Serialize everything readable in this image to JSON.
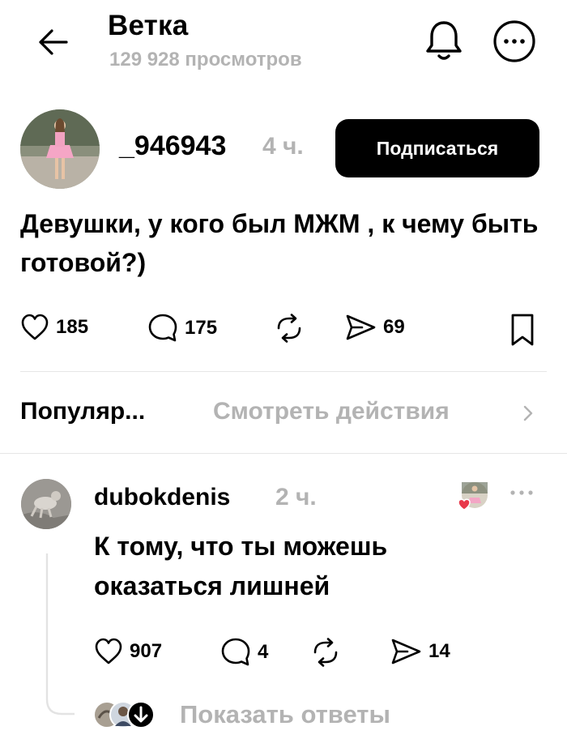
{
  "header": {
    "title": "Ветка",
    "views": "129 928 просмотров",
    "icons": {
      "back": "arrow-left-icon",
      "notifications": "bell-icon",
      "more": "more-horizontal-icon"
    }
  },
  "post": {
    "author": "_946943",
    "time": "4 ч.",
    "follow_label": "Подписаться",
    "text": "Девушки, у кого был МЖМ , к чему быть готовой?)",
    "likes": "185",
    "comments": "175",
    "shares": "69"
  },
  "sort": {
    "label": "Популяр...",
    "activity_label": "Смотреть действия"
  },
  "comment": {
    "author": "dubokdenis",
    "time": "2 ч.",
    "text": "К тому, что ты можешь оказаться лишней",
    "likes": "907",
    "comments": "4",
    "shares": "14",
    "show_replies": "Показать ответы"
  },
  "colors": {
    "text": "#000000",
    "muted": "#b3b3b3",
    "divider": "#e6e6e6",
    "button_bg": "#000000",
    "button_text": "#ffffff",
    "like_heart": "#e8394b"
  }
}
